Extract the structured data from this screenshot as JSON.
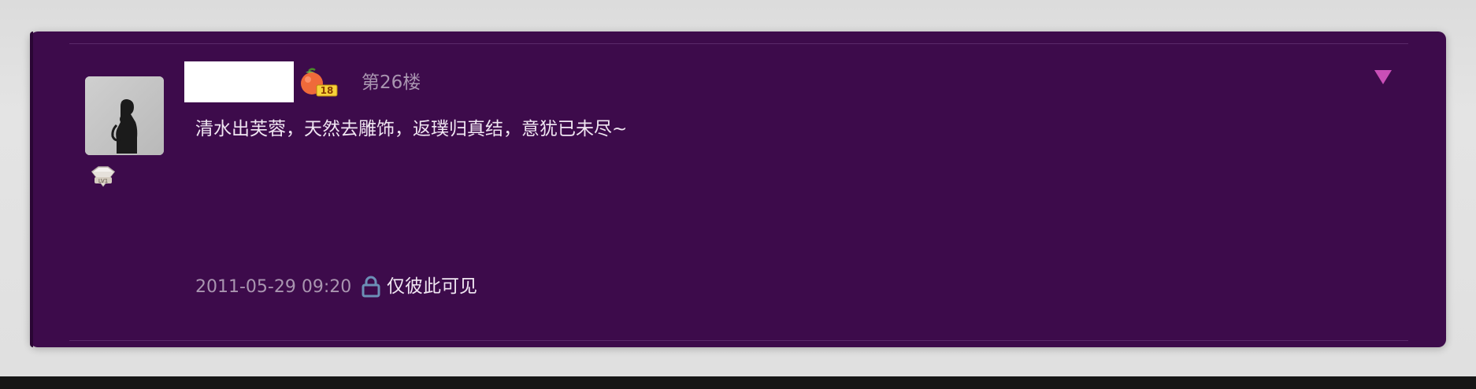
{
  "post": {
    "floor": "第26楼",
    "content": "清水出芙蓉，天然去雕饰，返璞归真结，意犹已未尽~",
    "timestamp": "2011-05-29 09:20",
    "privacy": "仅彼此可见",
    "vip_badge_number": "18",
    "level_badge_text": "LV1"
  },
  "icons": {
    "collapse": "triangle-down-icon",
    "privacy": "lock-icon",
    "vip": "vip-fruit-badge-icon",
    "level": "diamond-level-icon"
  },
  "colors": {
    "card_background": "#3d0b4b",
    "accent_arrow": "#c94fb7",
    "muted_text": "#a995b0",
    "body_text": "#f0e6f2",
    "lock_icon": "#6c8fb6"
  }
}
